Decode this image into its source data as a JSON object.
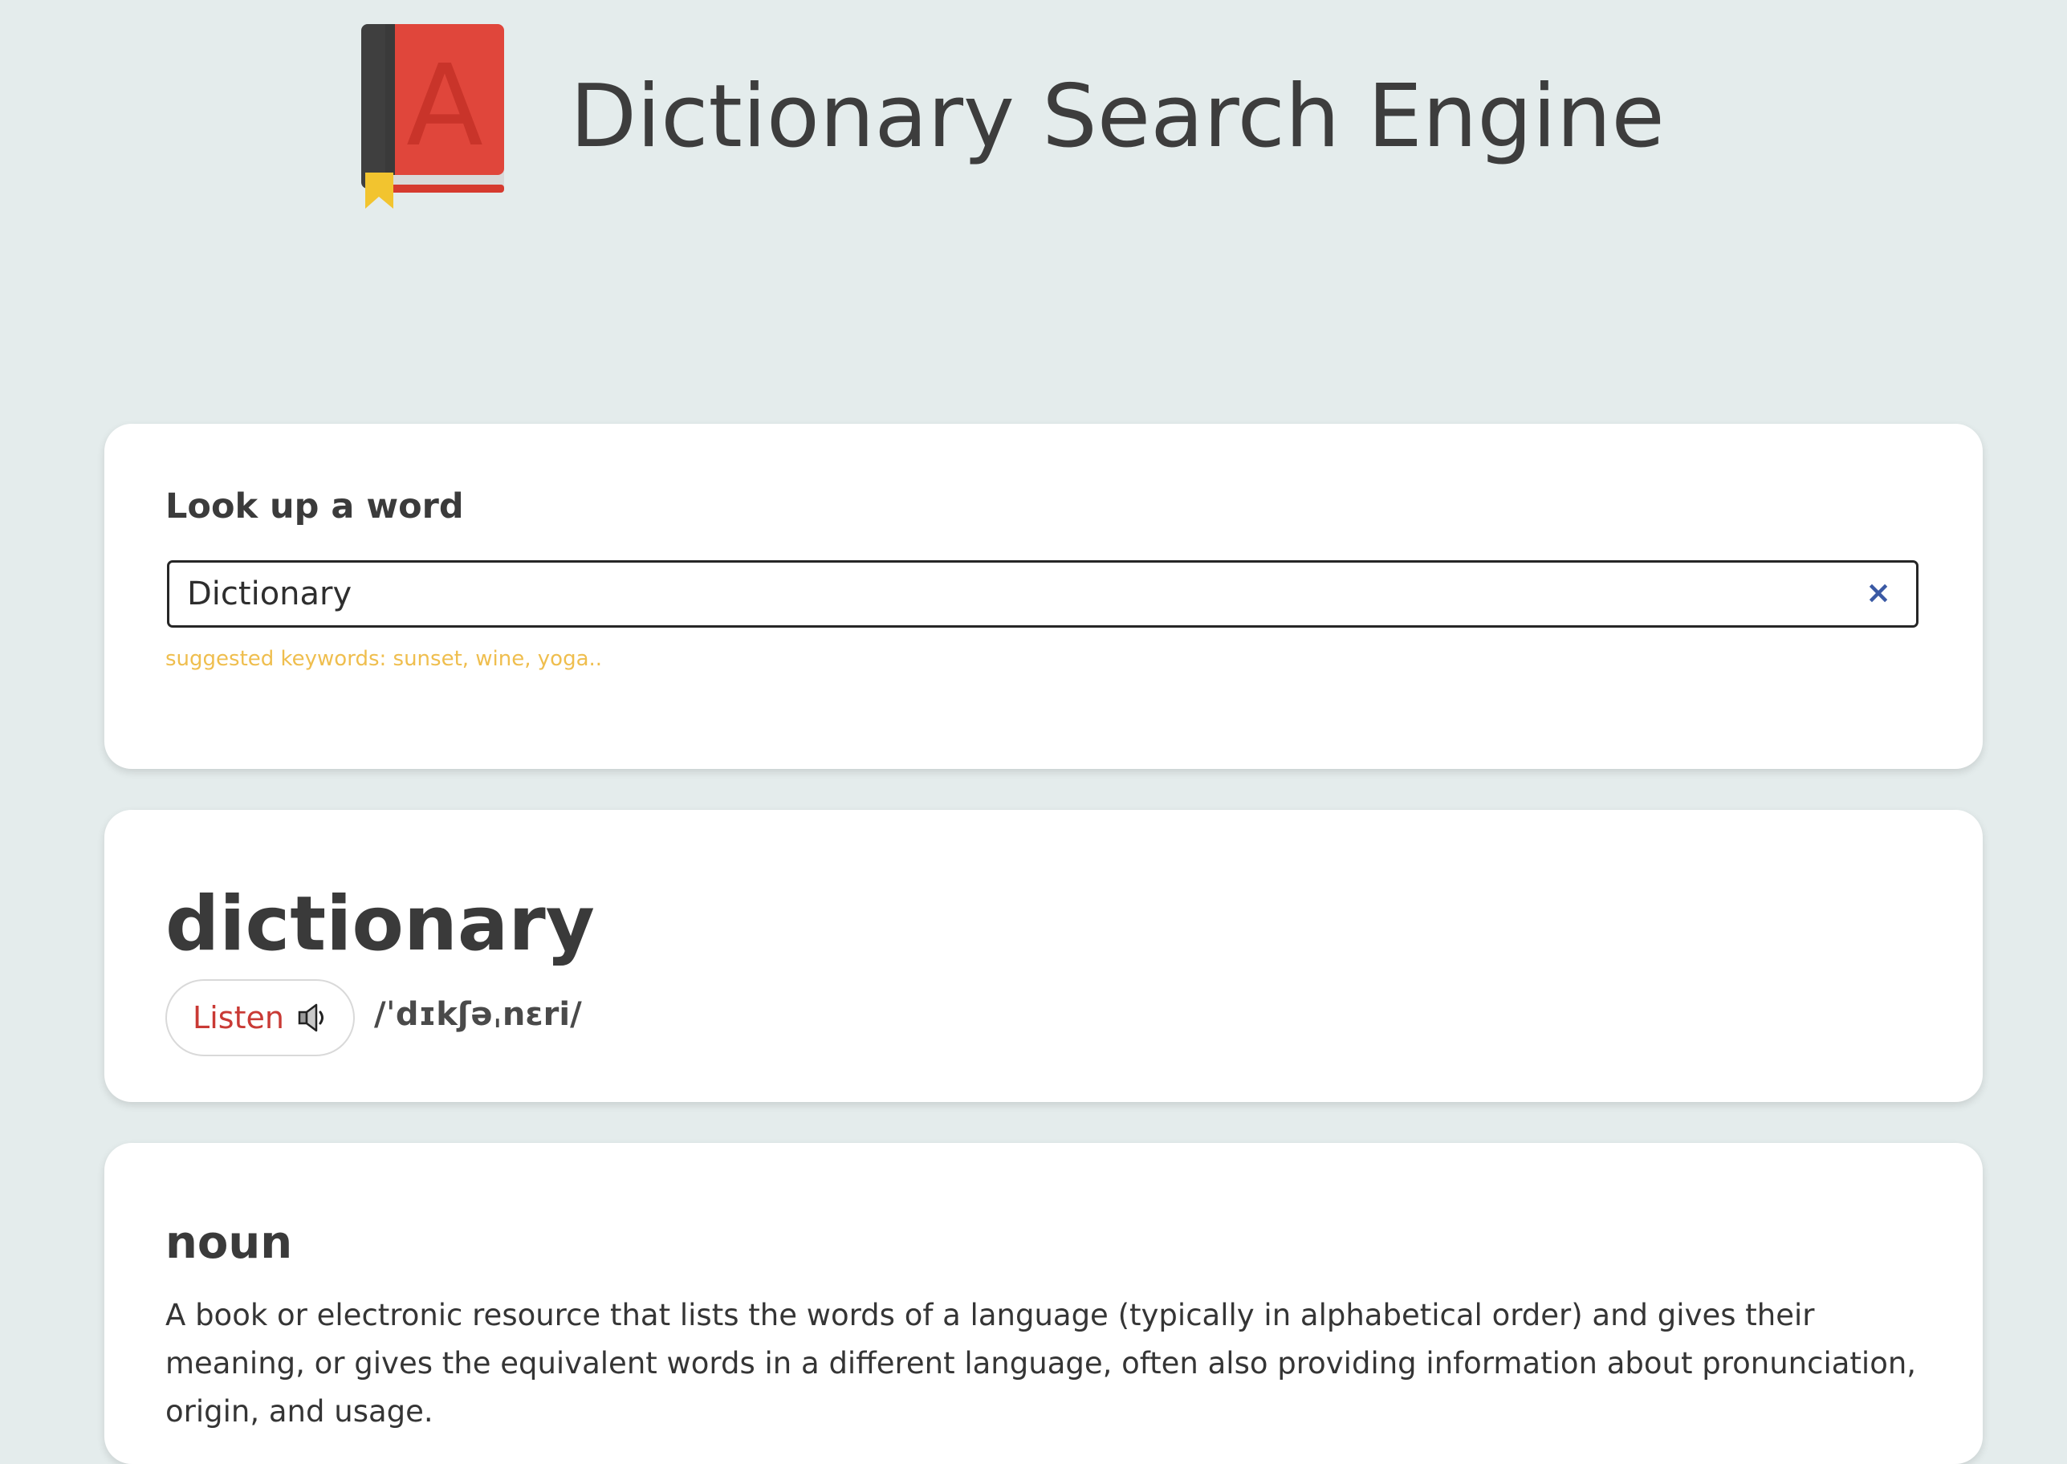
{
  "header": {
    "title": "Dictionary Search Engine",
    "logo_icon": "dictionary-book-icon",
    "logo_letter": "A"
  },
  "search": {
    "label": "Look up a word",
    "value": "Dictionary",
    "clear_icon": "close-icon",
    "clear_symbol": "×",
    "suggestion": "suggested keywords: sunset, wine, yoga.."
  },
  "word": {
    "title": "dictionary",
    "listen_label": "Listen",
    "speaker_icon": "speaker-icon",
    "phonetic": "/ˈdɪkʃəˌnɛri/"
  },
  "meaning": {
    "part_of_speech": "noun",
    "definition": "A book or electronic resource that lists the words of a language (typically in alphabetical order) and gives their meaning, or gives the equivalent words in a different language, often also providing information about pronunciation, origin, and usage."
  },
  "colors": {
    "background": "#e4ecec",
    "card": "#ffffff",
    "accent_red": "#c93a35",
    "clear_blue": "#3a59a4",
    "suggestion_yellow": "#efbe4e",
    "text_dark": "#3c3c3c"
  }
}
